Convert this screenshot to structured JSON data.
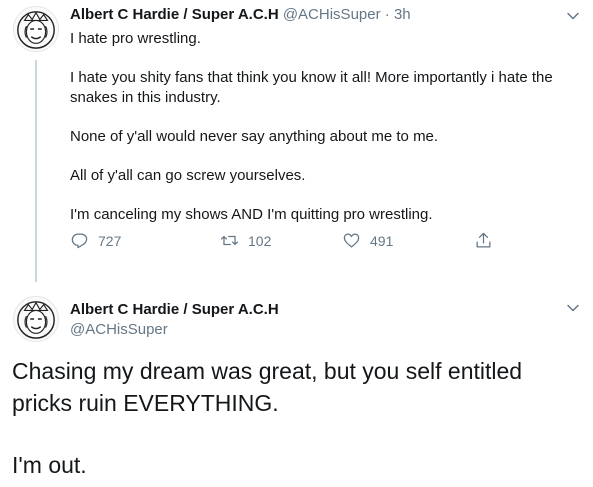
{
  "tweet1": {
    "author_name": "Albert C Hardie / Super A.C.H",
    "handle": "@ACHisSuper",
    "separator": "·",
    "time": "3h",
    "paragraphs": [
      "I hate pro wrestling.",
      "I hate you shity fans that think you know it all! More importantly i hate the snakes in this industry.",
      "None of y'all would never say anything about me to me.",
      "All of y'all can go screw yourselves.",
      "I'm canceling my shows AND I'm quitting pro wrestling."
    ],
    "actions": {
      "reply_count": "727",
      "retweet_count": "102",
      "like_count": "491"
    }
  },
  "tweet2": {
    "author_name": "Albert C Hardie / Super A.C.H",
    "handle": "@ACHisSuper",
    "paragraphs": [
      "Chasing my dream was great, but you self entitled pricks ruin EVERYTHING.",
      "I'm out."
    ]
  },
  "icons": {
    "reply": "reply-icon",
    "retweet": "retweet-icon",
    "like": "heart-icon",
    "share": "share-icon",
    "more": "chevron-down-icon"
  },
  "colors": {
    "text": "#14171a",
    "secondary": "#657786",
    "thread_line": "#ccd6dd"
  }
}
